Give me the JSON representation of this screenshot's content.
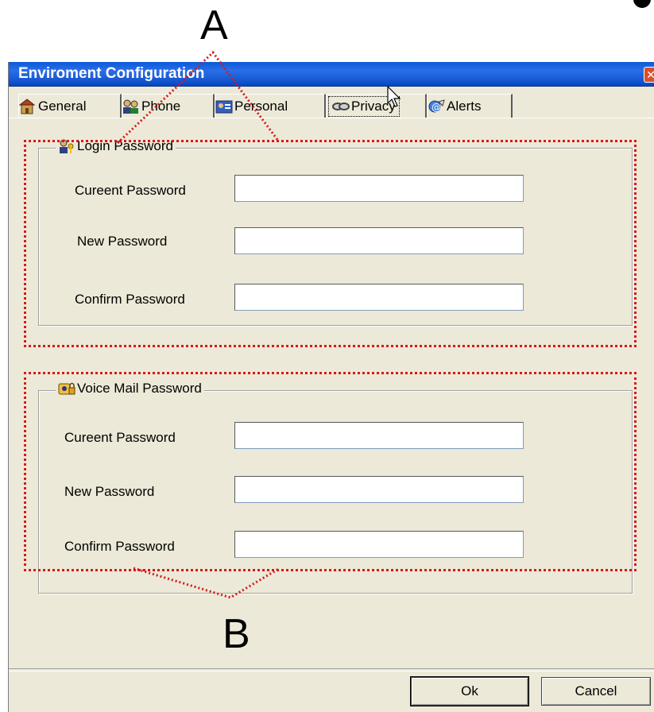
{
  "annotations": {
    "letter_a": "A",
    "letter_b": "B",
    "highlight_color": "#d61a1a"
  },
  "window": {
    "title": "Enviroment Configuration",
    "close_glyph": "✕",
    "titlebar_color": "#1d5fd8",
    "background_color": "#ece9d8"
  },
  "tabs": [
    {
      "label": "General",
      "icon": "house-icon",
      "active": false
    },
    {
      "label": "Phone",
      "icon": "users-icon",
      "active": false
    },
    {
      "label": "Personal",
      "icon": "id-card-icon",
      "active": false
    },
    {
      "label": "Privacy",
      "icon": "privacy-icon",
      "active": true
    },
    {
      "label": "Alerts",
      "icon": "alert-icon",
      "active": false
    }
  ],
  "login_group": {
    "legend": "Login Password",
    "icon": "user-key-icon",
    "fields": [
      {
        "label": "Cureent Password",
        "value": ""
      },
      {
        "label": "New Password",
        "value": ""
      },
      {
        "label": "Confirm Password",
        "value": ""
      }
    ]
  },
  "voicemail_group": {
    "legend": "Voice Mail Password",
    "icon": "voicemail-lock-icon",
    "fields": [
      {
        "label": "Cureent Password",
        "value": ""
      },
      {
        "label": "New Password",
        "value": ""
      },
      {
        "label": "Confirm Password",
        "value": ""
      }
    ]
  },
  "footer": {
    "ok_label": "Ok",
    "cancel_label": "Cancel"
  }
}
